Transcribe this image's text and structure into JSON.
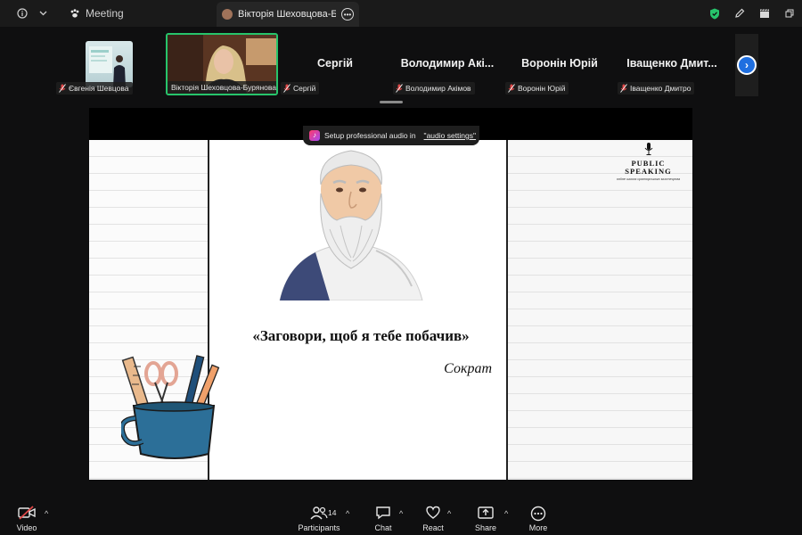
{
  "titlebar": {
    "meeting_label": "Meeting",
    "tab_title": "Вікторія Шеховцова-Бурянова's",
    "info_icon": "info-icon",
    "security_color": "#27c46b"
  },
  "participants": {
    "tiles": [
      {
        "label": "Євгенія Шевцова",
        "kind": "video"
      },
      {
        "label": "Вікторія Шеховцова-Бурянова",
        "kind": "active-video"
      },
      {
        "label": "Сергій",
        "big_name": "Сергій"
      },
      {
        "label": "Володимир Акімов",
        "big_name": "Володимир Акі..."
      },
      {
        "label": "Воронін Юрій",
        "big_name": "Воронін Юрій"
      },
      {
        "label": "Іващенко Дмитро",
        "big_name": "Іващенко Дмит..."
      }
    ],
    "active_border_color": "#27c46b"
  },
  "audio_banner": {
    "text": "Setup professional audio in",
    "link": "\"audio settings\""
  },
  "slide": {
    "quote": "«Заговори, щоб я тебе побачив»",
    "author": "Сократ",
    "brand_line1": "PUBLIC",
    "brand_line2": "SPEAKING",
    "brand_sub": "online школа ораторського мистецтва"
  },
  "toolbar": {
    "video_label": "Video",
    "participants_label": "Participants",
    "participants_count": "14",
    "chat_label": "Chat",
    "react_label": "React",
    "share_label": "Share",
    "more_label": "More"
  }
}
